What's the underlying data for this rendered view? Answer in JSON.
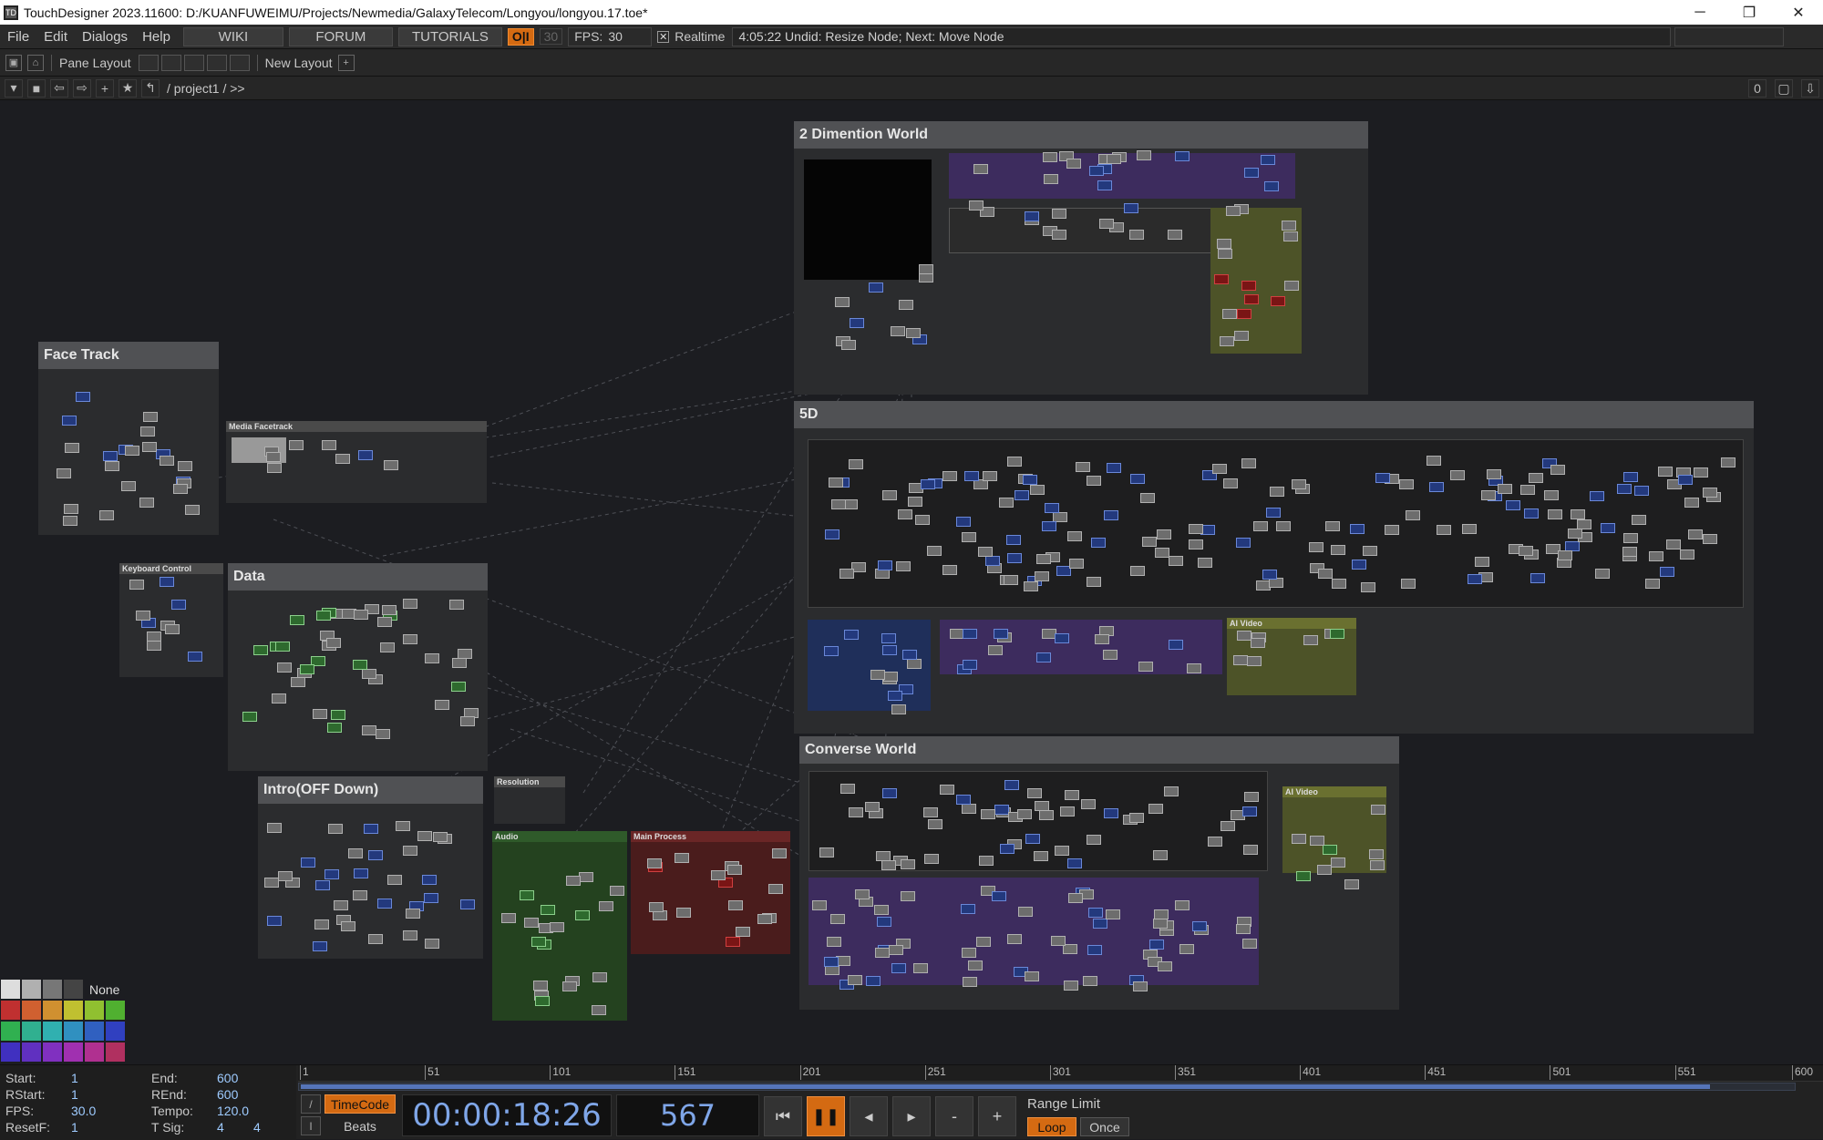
{
  "window": {
    "title": "TouchDesigner 2023.11600: D:/KUANFUWEIMU/Projects/Newmedia/GalaxyTelecom/Longyou/longyou.17.toe*",
    "controls": [
      "─",
      "❐",
      "✕"
    ]
  },
  "menubar": {
    "items": [
      "File",
      "Edit",
      "Dialogs",
      "Help"
    ],
    "links": [
      "WIKI",
      "FORUM",
      "TUTORIALS"
    ],
    "oi_label": "O|I",
    "fps_disabled": "30",
    "fps_label": "FPS:",
    "fps_value": "30",
    "realtime_label": "Realtime",
    "realtime_checked": "✕",
    "undo_status": "4:05:22 Undid: Resize Node; Next: Move Node"
  },
  "panebar": {
    "pane_layout_label": "Pane Layout",
    "new_layout_label": "New Layout",
    "add_label": "+"
  },
  "pathbar": {
    "path": "/ project1 / >>",
    "right_value": "0"
  },
  "network": {
    "boxes": {
      "two_d": "2 Dimention World",
      "five_d": "5D",
      "converse": "Converse World",
      "face_track": "Face Track",
      "data": "Data",
      "intro": "Intro(OFF Down)",
      "media_facetrack": "Media Facetrack",
      "keyboard_control": "Keyboard Control",
      "resolution": "Resolution",
      "audio": "Audio",
      "main_process": "Main Process",
      "ai_video_1": "AI Video",
      "ai_video_2": "AI Video"
    }
  },
  "palette": {
    "none_label": "None",
    "colors": [
      "#dddddd",
      "#b0b0b0",
      "#777777",
      "#444444",
      "#1c1d21",
      "#1c1d21",
      "#c03030",
      "#d06030",
      "#d09030",
      "#c0c030",
      "#90c030",
      "#50b030",
      "#30b050",
      "#30b090",
      "#30b0b0",
      "#3090c0",
      "#3060c0",
      "#3040c0",
      "#4030c0",
      "#6030c0",
      "#8030c0",
      "#a030b0",
      "#b03090",
      "#b03060"
    ]
  },
  "stats": {
    "start_label": "Start:",
    "start_value": "1",
    "end_label": "End:",
    "end_value": "600",
    "rstart_label": "RStart:",
    "rstart_value": "1",
    "rend_label": "REnd:",
    "rend_value": "600",
    "fps_label": "FPS:",
    "fps_value": "30.0",
    "tempo_label": "Tempo:",
    "tempo_value": "120.0",
    "resetf_label": "ResetF:",
    "resetf_value": "1",
    "tsig_label": "T Sig:",
    "tsig_value_1": "4",
    "tsig_value_2": "4"
  },
  "timeline": {
    "ticks": [
      "1",
      "51",
      "101",
      "151",
      "201",
      "251",
      "301",
      "351",
      "401",
      "451",
      "501",
      "551",
      "600"
    ],
    "current_frame": 567,
    "range": [
      1,
      600
    ]
  },
  "transport": {
    "timecode_label": "TimeCode",
    "beats_label": "Beats",
    "slash_label": "/",
    "bar_label": "I",
    "timecode": "00:00:18:26",
    "frame": "567",
    "range_limit_label": "Range Limit",
    "loop_label": "Loop",
    "once_label": "Once"
  }
}
